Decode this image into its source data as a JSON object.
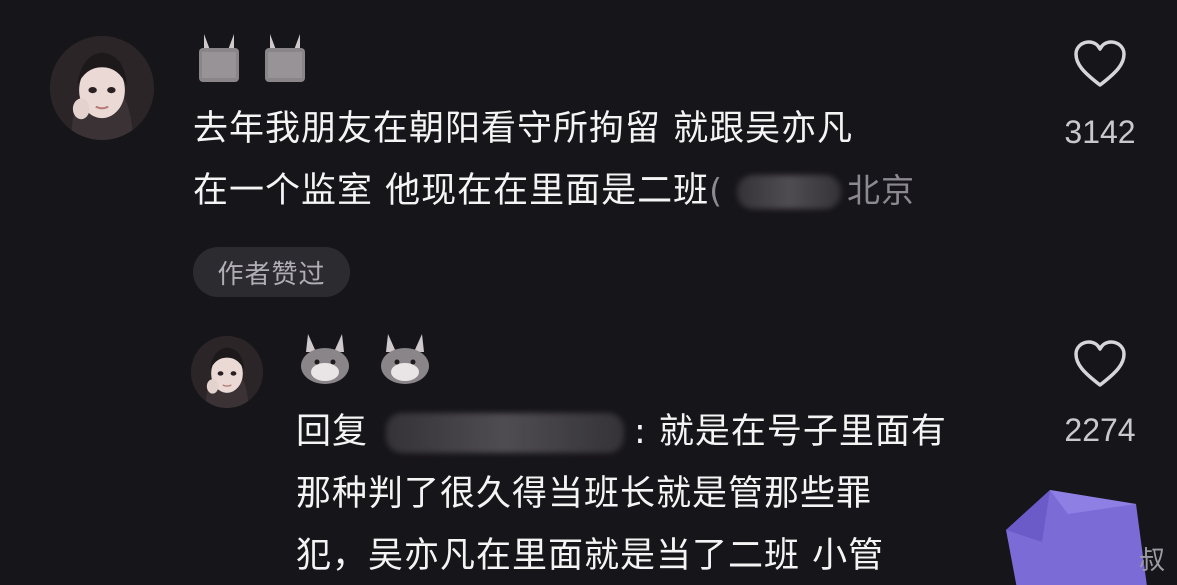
{
  "comment": {
    "line1": "去年我朋友在朝阳看守所拘留 就跟吴亦凡",
    "line2": "在一个监室 他现在在里面是二班",
    "location_prefix": "(",
    "location": "北京",
    "badge": "作者赞过",
    "likes": "3142"
  },
  "reply": {
    "line1_prefix": "回复",
    "line1_suffix": ": 就是在号子里面有",
    "line2": "那种判了很久得当班长就是管那些罪",
    "line3": "犯，吴亦凡在里面就是当了二班 小管",
    "likes": "2274"
  },
  "corner_text": "叔",
  "colors": {
    "background": "#161519",
    "text": "#f4f4f4",
    "muted": "#8c8a90",
    "badge_bg": "#2c2b30",
    "sticker": "#7b6bd6"
  },
  "icons": [
    "avatar",
    "bunny-icon",
    "heart-icon"
  ]
}
